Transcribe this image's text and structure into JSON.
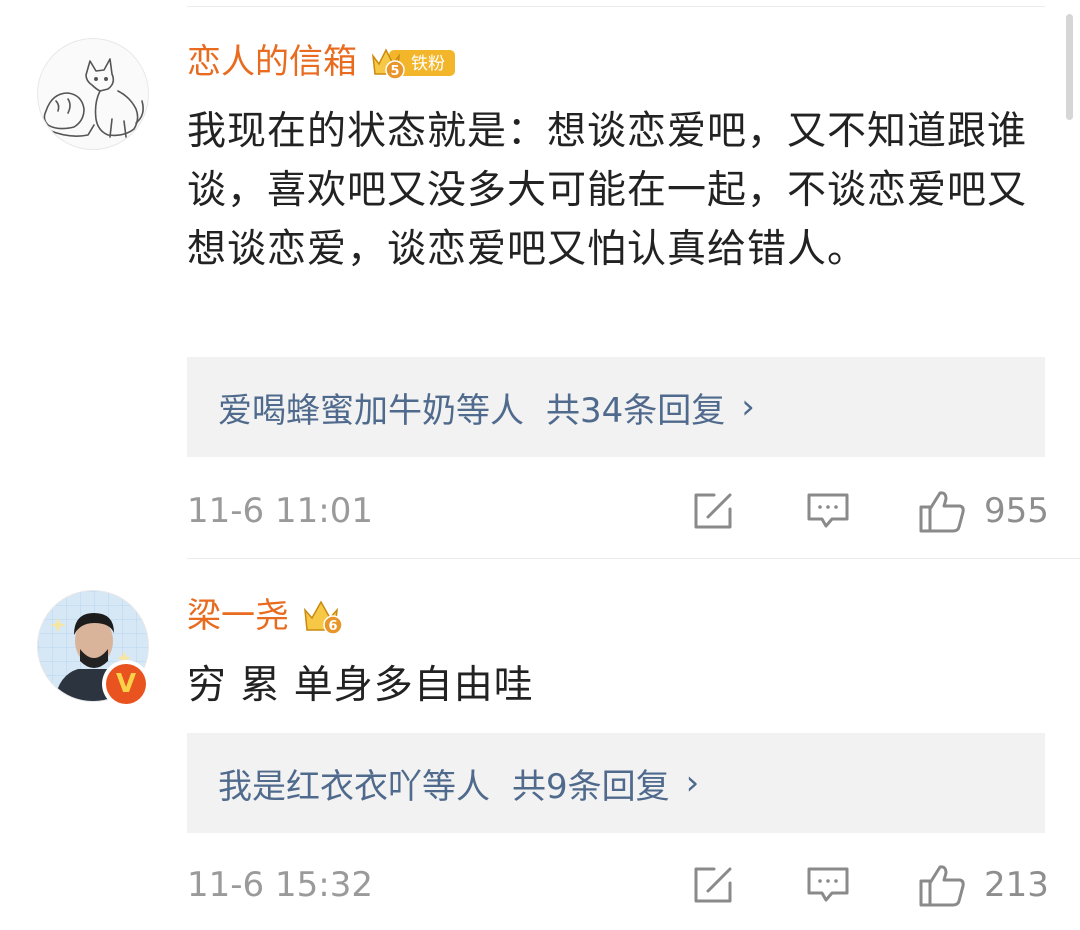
{
  "comments": [
    {
      "username": "恋人的信箱",
      "badge_level": "5",
      "badge_label": "铁粉",
      "text": "我现在的状态就是：想谈恋爱吧，又不知道跟谁谈，喜欢吧又没多大可能在一起，不谈恋爱吧又想谈恋爱，谈恋爱吧又怕认真给错人。",
      "reply_summary": "爱喝蜂蜜加牛奶等人",
      "reply_count": "共34条回复",
      "reply_chevron": "›",
      "timestamp": "11-6 11:01",
      "likes": "955"
    },
    {
      "username": "梁一尧",
      "badge_level": "6",
      "verified_mark": "V",
      "text": "穷 累 单身多自由哇",
      "reply_summary": "我是红衣衣吖等人",
      "reply_count": "共9条回复",
      "reply_chevron": "›",
      "timestamp": "11-6 15:32",
      "likes": "213"
    }
  ],
  "colors": {
    "username": "#e86b1f",
    "reply_link": "#4f6a8c",
    "meta": "#9a9a9a",
    "badge_gold": "#f3b62b",
    "verified": "#e9531f"
  }
}
